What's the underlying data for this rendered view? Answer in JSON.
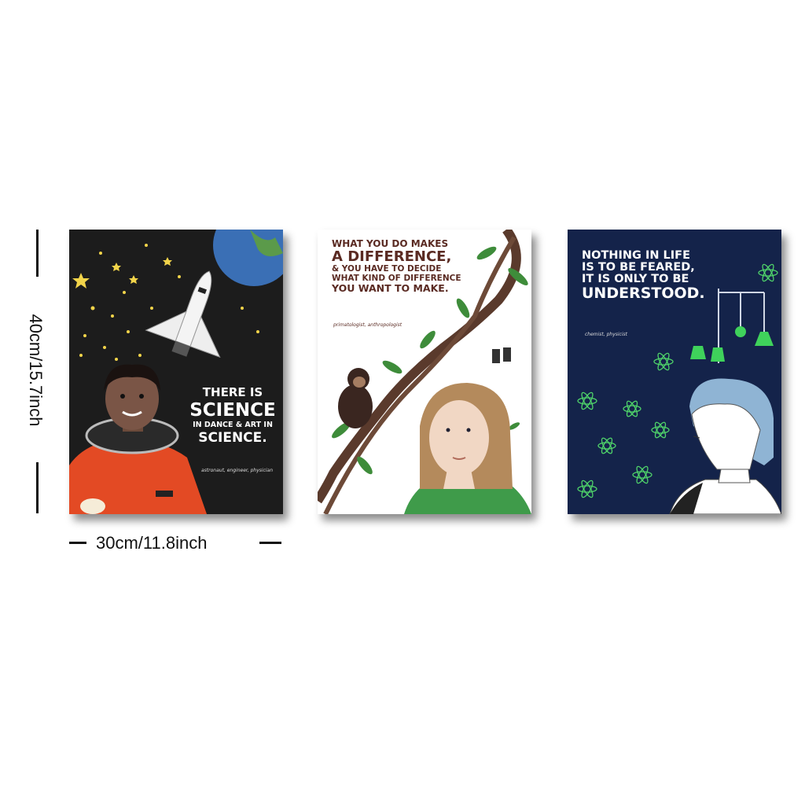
{
  "dimensions": {
    "height_label": "40cm/15.7inch",
    "width_label": "30cm/11.8inch"
  },
  "posters": [
    {
      "background": "#1c1c1c",
      "quote_lines": [
        "THERE IS",
        "SCIENCE",
        "IN DANCE & ART IN",
        "SCIENCE."
      ],
      "caption": "astronaut, engineer, physician"
    },
    {
      "background": "#ffffff",
      "quote_lines": [
        "WHAT YOU DO MAKES",
        "A DIFFERENCE,",
        "& YOU HAVE TO DECIDE",
        "WHAT KIND OF DIFFERENCE",
        "YOU WANT TO MAKE."
      ],
      "caption": "primatologist, anthropologist"
    },
    {
      "background": "#14234a",
      "quote_lines": [
        "NOTHING IN LIFE",
        "IS TO BE FEARED,",
        "IT IS ONLY TO BE",
        "UNDERSTOOD."
      ],
      "caption": "chemist, physicist"
    }
  ]
}
